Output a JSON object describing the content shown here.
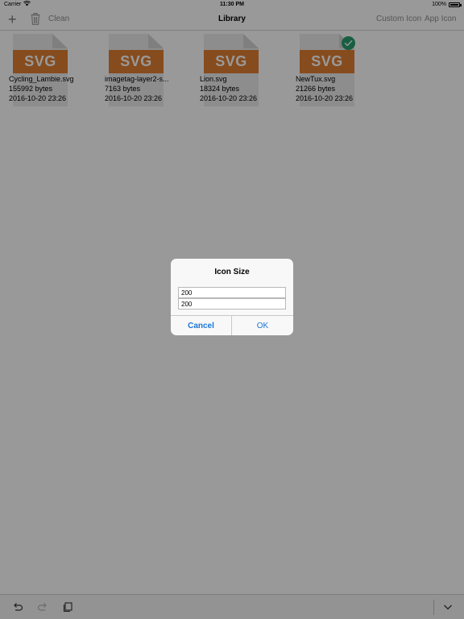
{
  "status_bar": {
    "carrier": "Carrier",
    "time": "11:30 PM",
    "battery": "100%"
  },
  "nav": {
    "add": "+",
    "clean": "Clean",
    "title": "Library",
    "custom_icon": "Custom Icon",
    "app_icon": "App Icon"
  },
  "files": [
    {
      "badge": "SVG",
      "name": "Cycling_Lambie.svg",
      "size": "155992 bytes",
      "date": "2016-10-20 23:26",
      "selected": false
    },
    {
      "badge": "SVG",
      "name": "imagetag-layer2-s...",
      "size": "7163 bytes",
      "date": "2016-10-20 23:26",
      "selected": false
    },
    {
      "badge": "SVG",
      "name": "Lion.svg",
      "size": "18324 bytes",
      "date": "2016-10-20 23:26",
      "selected": false
    },
    {
      "badge": "SVG",
      "name": "NewTux.svg",
      "size": "21266 bytes",
      "date": "2016-10-20 23:26",
      "selected": true
    }
  ],
  "dialog": {
    "title": "Icon Size",
    "width_value": "200",
    "height_value": "200",
    "cancel_label": "Cancel",
    "ok_label": "OK"
  },
  "toolbar": {
    "icons": [
      "undo-icon",
      "redo-icon",
      "paste-icon",
      "chevron-down-icon"
    ]
  },
  "colors": {
    "svg_badge": "#e07f33",
    "selected_check": "#2a9d70",
    "dialog_button": "#1a74d8"
  }
}
